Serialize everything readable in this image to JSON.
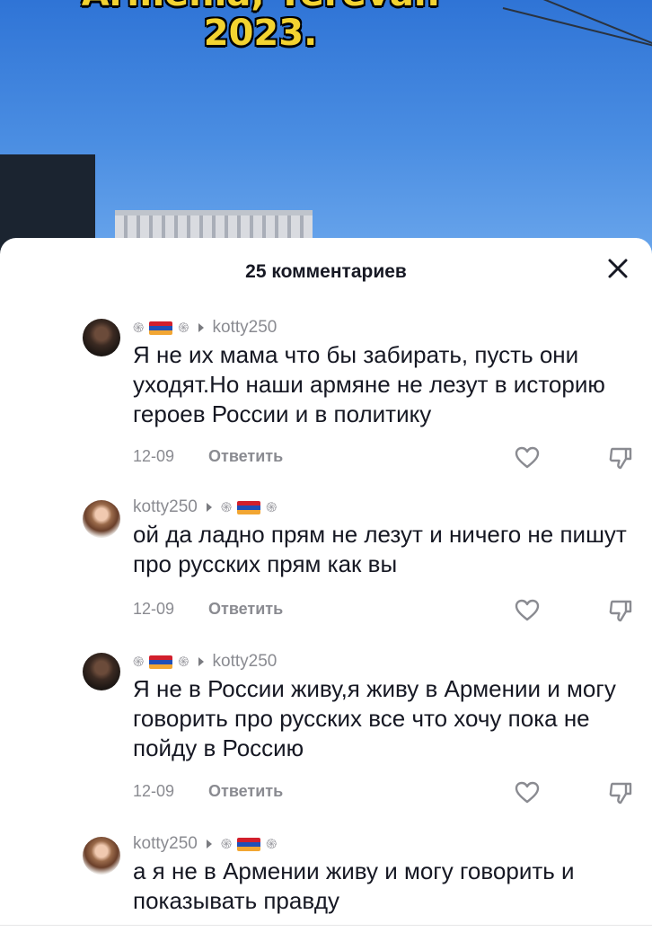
{
  "video": {
    "overlay_top": "Armenia, Yerevan",
    "overlay_year": "2023."
  },
  "sheet": {
    "title": "25 комментариев"
  },
  "comments": [
    {
      "author": "kotty250",
      "text": "Я не их мама что бы забирать, пусть они уходят.Но наши армяне не лезут в историю героев России и в политику",
      "date": "12-09",
      "reply_label": "Ответить"
    },
    {
      "author": "kotty250",
      "text": "ой да ладно прям не лезут и ничего не пишут про русских прям как вы",
      "date": "12-09",
      "reply_label": "Ответить"
    },
    {
      "author": "kotty250",
      "text": "Я не в России живу,я живу в Армении и могу говорить про русских все что хочу пока не пойду в Россию",
      "date": "12-09",
      "reply_label": "Ответить"
    },
    {
      "author": "kotty250",
      "text": "а я не в Армении живу и могу говорить и показывать правду"
    }
  ],
  "icons": {
    "close": "close-icon",
    "like": "heart-icon",
    "dislike": "dislike-icon",
    "flag": "armenia-flag-icon",
    "spiral": "eternity-sign-icon"
  },
  "colors": {
    "flag_red": "#d21f2c",
    "flag_blue": "#1f4fb8",
    "flag_orange": "#f2a633",
    "text_primary": "#161823",
    "text_secondary": "#8a8b91"
  }
}
